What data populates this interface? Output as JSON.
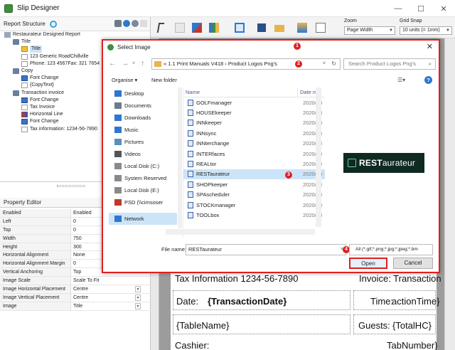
{
  "window": {
    "title": "Slip Designer",
    "controls": [
      "—",
      "☐",
      "✕"
    ]
  },
  "report_structure": {
    "label": "Report Structure",
    "tree": [
      {
        "label": "Restaurateur Designed Report",
        "icon": "report",
        "level": 0
      },
      {
        "label": "Title",
        "icon": "section",
        "level": 1
      },
      {
        "label": "Title",
        "icon": "img",
        "level": 2,
        "selected": true
      },
      {
        "label": "123 Generic RoadChillville",
        "icon": "text",
        "level": 2
      },
      {
        "label": "Phone: 123 4567Fax: 321 7654",
        "icon": "text",
        "level": 2
      },
      {
        "label": "Copy",
        "icon": "section",
        "level": 1
      },
      {
        "label": "Font Change",
        "icon": "font",
        "level": 2
      },
      {
        "label": "{CopyText}",
        "icon": "text",
        "level": 2
      },
      {
        "label": "Transaction invoice",
        "icon": "section",
        "level": 1
      },
      {
        "label": "Font Change",
        "icon": "font",
        "level": 2
      },
      {
        "label": "Tax Invoice",
        "icon": "text",
        "level": 2
      },
      {
        "label": "Horizontal Line",
        "icon": "line",
        "level": 2
      },
      {
        "label": "Font Change",
        "icon": "font",
        "level": 2
      },
      {
        "label": "Tax information: 1234-56-7890",
        "icon": "text",
        "level": 2
      }
    ]
  },
  "property_editor": {
    "label": "Property Editor",
    "rows": [
      {
        "name": "Enabled",
        "value": "Enabled"
      },
      {
        "name": "Left",
        "value": "0"
      },
      {
        "name": "Top",
        "value": "0"
      },
      {
        "name": "Width",
        "value": "750"
      },
      {
        "name": "Height",
        "value": "300"
      },
      {
        "name": "Horizontal Alignment",
        "value": "None"
      },
      {
        "name": "Horizontal Alignment Margin",
        "value": "0"
      },
      {
        "name": "Vertical Anchoring",
        "value": "Top"
      },
      {
        "name": "Image Scale",
        "value": "Scale To Fit"
      },
      {
        "name": "Image Horizontal Placement",
        "value": "Centre"
      },
      {
        "name": "Image Vertical Placement",
        "value": "Centre"
      },
      {
        "name": "Image",
        "value": "Title"
      }
    ]
  },
  "toolbar": {
    "zoom_label": "Zoom",
    "zoom_value": "Page Width",
    "snap_label": "Grid Snap",
    "snap_value": "10 units (= 1mm)"
  },
  "canvas": {
    "lines": [
      {
        "text": "Tax Information 1234-56-7890"
      },
      {
        "text": "Invoice: Transaction"
      },
      {
        "label": "Date:",
        "field": "{TransactionDate}"
      },
      {
        "label": "Time:",
        "field": "actionTime}"
      },
      {
        "field": "{TableName}"
      },
      {
        "label": "Guests:",
        "field": "{TotalHC}"
      },
      {
        "text": "Cashier:"
      },
      {
        "text": "TabNumber}"
      }
    ]
  },
  "dialog": {
    "title": "Select Image",
    "breadcrumb": "« 1.1 Print Manuals V418 › Product Logos Png's",
    "search_placeholder": "Search Product Logos Png's",
    "organise": "Organise ▾",
    "new_folder": "New folder",
    "nav_items": [
      {
        "label": "Desktop",
        "color": "#2e77d0"
      },
      {
        "label": "Documents",
        "color": "#6b7b8c"
      },
      {
        "label": "Downloads",
        "color": "#2e77d0"
      },
      {
        "label": "Music",
        "color": "#2e77d0"
      },
      {
        "label": "Pictures",
        "color": "#5a8fc0"
      },
      {
        "label": "Videos",
        "color": "#555555"
      },
      {
        "label": "Local Disk (C:)",
        "color": "#8a8a8a"
      },
      {
        "label": "System Reserved",
        "color": "#8a8a8a"
      },
      {
        "label": "Local Disk (E:)",
        "color": "#8a8a8a"
      },
      {
        "label": "PSD (\\\\cimsoser",
        "color": "#c0392b"
      },
      {
        "label": "Network",
        "color": "#2e77d0",
        "active": true
      }
    ],
    "columns": {
      "name": "Name",
      "date": "Date m"
    },
    "files": [
      {
        "name": "GOLFmanager",
        "date": "2020/03"
      },
      {
        "name": "HOUSEkeeper",
        "date": "2020/03"
      },
      {
        "name": "INNkeeper",
        "date": "2020/03"
      },
      {
        "name": "INNsync",
        "date": "2020/03"
      },
      {
        "name": "INNterchange",
        "date": "2020/03"
      },
      {
        "name": "INTERfaces",
        "date": "2020/03"
      },
      {
        "name": "REALtor",
        "date": "2020/03"
      },
      {
        "name": "RESTaurateur",
        "date": "2020/03",
        "selected": true
      },
      {
        "name": "SHOPkeeper",
        "date": "2020/03"
      },
      {
        "name": "SPAscheduler",
        "date": "2020/03"
      },
      {
        "name": "STOCKmanager",
        "date": "2020/03"
      },
      {
        "name": "TOOLbox",
        "date": "2020/03"
      }
    ],
    "preview": {
      "bold": "REST",
      "thin": "aurateur"
    },
    "file_name_label": "File name:",
    "file_name_value": "RESTaurateur",
    "file_type": "All (*.gif;*.png;*.jpg;*.jpeg;*.bm",
    "open_label": "Open",
    "cancel_label": "Cancel",
    "badges": [
      "1",
      "2",
      "3",
      "4"
    ]
  },
  "colors": {
    "highlight": "#e02020",
    "selection": "#cce4f7",
    "accent": "#0e2a22"
  }
}
